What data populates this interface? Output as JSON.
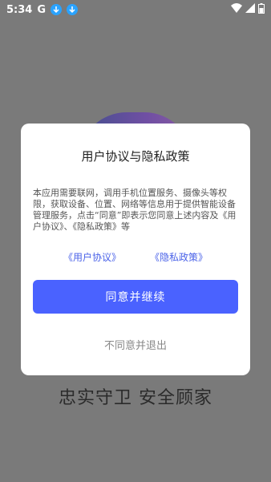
{
  "status_bar": {
    "time": "5:34",
    "g_label": "G",
    "icons": [
      "google-icon",
      "download-icon",
      "download-icon",
      "wifi-icon",
      "signal-icon",
      "battery-icon"
    ]
  },
  "background": {
    "slogan": "忠实守卫 安全顾家"
  },
  "dialog": {
    "title": "用户协议与隐私政策",
    "body": "本应用需要联网，调用手机位置服务、摄像头等权限，获取设备、位置、网络等信息用于提供智能设备管理服务，点击“同意”即表示您同意上述内容及《用户协议》、《隐私政策》等",
    "user_agreement_link": "《用户协议》",
    "privacy_policy_link": "《隐私政策》",
    "agree_button": "同意并继续",
    "disagree_button": "不同意并退出"
  },
  "colors": {
    "accent": "#4a62ff",
    "link": "#4a62e8",
    "overlay": "#7a7a7a"
  }
}
